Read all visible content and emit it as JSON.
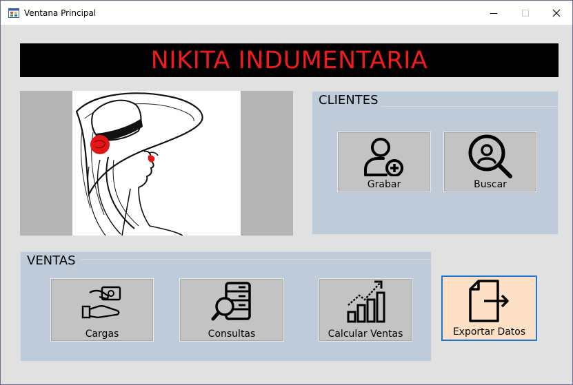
{
  "window": {
    "title": "Ventana Principal",
    "controls": [
      "minimize",
      "maximize",
      "close"
    ]
  },
  "banner": {
    "text": "NIKITA INDUMENTARIA",
    "background": "#000000",
    "color": "#ee1c1c"
  },
  "clientes": {
    "title": "CLIENTES",
    "buttons": [
      {
        "label": "Grabar",
        "icon": "user-plus-icon"
      },
      {
        "label": "Buscar",
        "icon": "search-user-icon"
      }
    ]
  },
  "ventas": {
    "title": "VENTAS",
    "buttons": [
      {
        "label": "Cargas",
        "icon": "hand-money-icon"
      },
      {
        "label": "Consultas",
        "icon": "database-search-icon"
      },
      {
        "label": "Calcular Ventas",
        "icon": "growth-chart-icon"
      }
    ]
  },
  "export": {
    "label": "Exportar Datos",
    "icon": "file-export-icon",
    "background": "#fde0c6",
    "border": "#1a78d4"
  },
  "picture": {
    "icon": "woman-hat-illustration"
  }
}
